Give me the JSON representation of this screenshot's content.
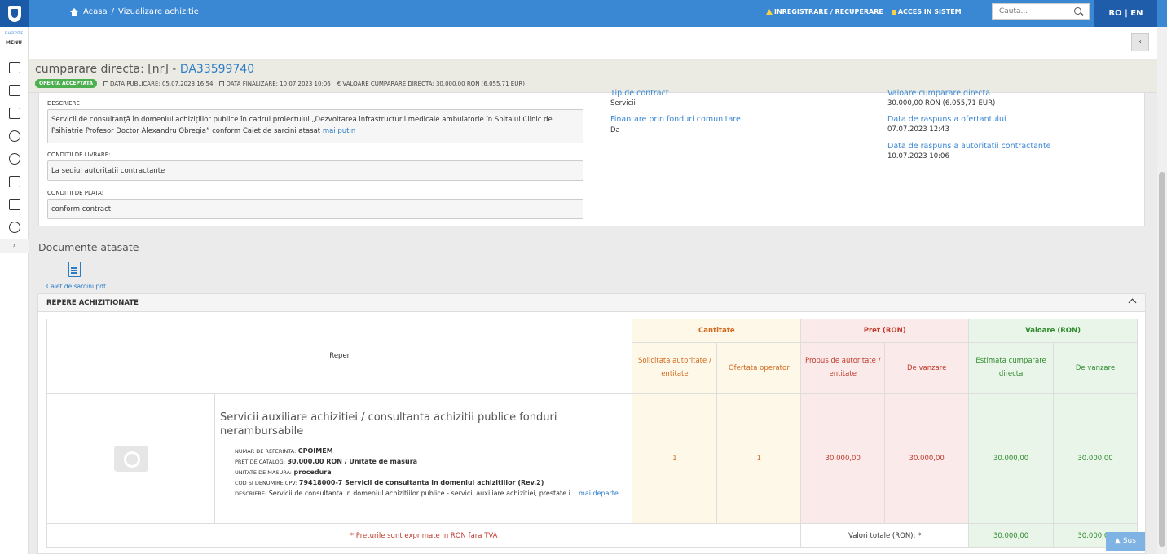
{
  "topbar": {
    "breadcrumb_home": "Acasa",
    "breadcrumb_sep": "/",
    "breadcrumb_current": "Vizualizare achizitie",
    "link_register": "INREGISTRARE / RECUPERARE",
    "link_login": "ACCES IN SISTEM",
    "search_placeholder": "Cauta...",
    "lang": "RO | EN"
  },
  "sidebar": {
    "logo_small": "E-LICITATIE",
    "menu_label": "MENU"
  },
  "header": {
    "title_prefix": "cumparare directa: [nr] -",
    "title_code": "DA33599740",
    "badge": "OFERTA ACCEPTATA",
    "data_publicare": "DATA PUBLICARE: 05.07.2023 16:54",
    "data_finalizare": "DATA FINALIZARE: 10.07.2023 10:06",
    "valoare": "€ VALOARE CUMPARARE DIRECTA: 30.000,00 RON (6.055,71 EUR)"
  },
  "details": {
    "descriere_label": "DESCRIERE",
    "descriere_text": "Servicii de consultanță în domeniul achizițiilor publice în cadrul proiectului „Dezvoltarea infrastructurii medicale ambulatorie în Spitalul Clinic de Psihiatrie Profesor Doctor Alexandru Obregia” conform Caiet de sarcini atasat",
    "descriere_more": "mai putin",
    "livrare_label": "CONDITII DE LIVRARE:",
    "livrare_text": "La sediul autoritatii contractante",
    "plata_label": "CONDITII DE PLATA:",
    "plata_text": "conform contract",
    "tip_contract_label": "Tip de contract",
    "tip_contract_val": "Servicii",
    "fonduri_label": "Finantare prin fonduri comunitare",
    "fonduri_val": "Da",
    "valoare_label": "Valoare cumparare directa",
    "valoare_val": "30.000,00  RON (6.055,71  EUR)",
    "raspuns_ofertant_label": "Data de raspuns a ofertantului",
    "raspuns_ofertant_val": "07.07.2023 12:43",
    "raspuns_autoritate_label": "Data de raspuns a autoritatii contractante",
    "raspuns_autoritate_val": "10.07.2023 10:06"
  },
  "documents": {
    "title": "Documente atasate",
    "file": "Caiet de sarcini.pdf"
  },
  "repere": {
    "title": "REPERE ACHIZITIONATE",
    "col_reper": "Reper",
    "col_cantitate": "Cantitate",
    "col_pret": "Pret (RON)",
    "col_valoare": "Valoare (RON)",
    "sub_solicitata": "Solicitata autoritate / entitate",
    "sub_ofertata": "Ofertata operator",
    "sub_propus": "Propus de autoritate / entitate",
    "sub_devanzare_pret": "De vanzare",
    "sub_estimata": "Estimata cumparare directa",
    "sub_devanzare_val": "De vanzare",
    "item": {
      "title": "Servicii auxiliare achizitiei / consultanta achizitii publice fonduri nerambursabile",
      "ref_label": "NUMAR DE REFERINTA:",
      "ref_val": "CPOIMEM",
      "pret_label": "PRET DE CATALOG:",
      "pret_val": "30.000,00  RON / Unitate de masura",
      "um_label": "UNITATE DE MASURA:",
      "um_val": "procedura",
      "cpv_label": "COD SI DENUMIRE CPV:",
      "cpv_val": "79418000-7 Servicii de consultanta in domeniul achizitiilor (Rev.2)",
      "desc_label": "DESCRIERE:",
      "desc_val": "Servicii de consultanta in domeniul achizitiilor publice - servicii auxiliare achizitiei, prestate i...",
      "desc_more": "mai departe",
      "solicitata": "1",
      "ofertata": "1",
      "pret_propus": "30.000,00",
      "pret_vanzare": "30.000,00",
      "val_estimata": "30.000,00",
      "val_vanzare": "30.000,00"
    },
    "footer_note": "* Preturile sunt exprimate in RON fara TVA",
    "totals_label": "Valori totale (RON): *",
    "total_estimata": "30.000,00",
    "total_vanzare": "30.000,00"
  },
  "scroll_top": "Sus"
}
